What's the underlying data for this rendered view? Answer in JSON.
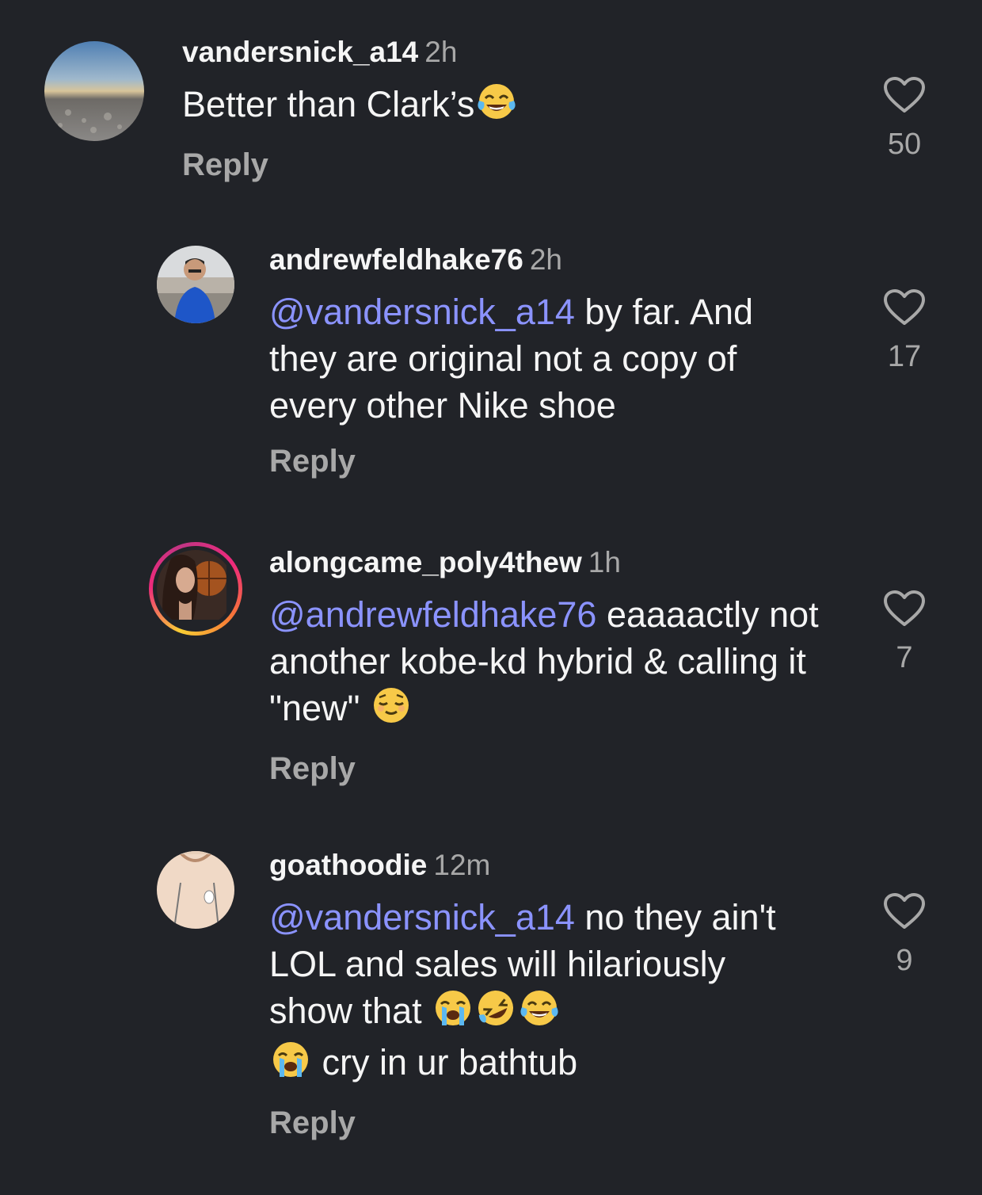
{
  "comments": [
    {
      "username": "vandersnick_a14",
      "time": "2h",
      "text": "Better than Clark’s",
      "emoji_after": "tears-of-joy-emoji",
      "reply_label": "Reply",
      "likes": "50"
    },
    {
      "username": "andrewfeldhake76",
      "time": "2h",
      "mention": "@vandersnick_a14",
      "text": " by far. And they are original not a copy of every other Nike shoe",
      "reply_label": "Reply",
      "likes": "17"
    },
    {
      "username": "alongcame_poly4thew",
      "time": "1h",
      "mention": "@andrewfeldhake76",
      "text": " eaaaactly not another kobe-kd hybrid & calling it \"new\" ",
      "emoji_after": "relieved-face-emoji",
      "reply_label": "Reply",
      "likes": "7"
    },
    {
      "username": "goathoodie",
      "time": "12m",
      "mention": "@vandersnick_a14",
      "text": " no they ain't LOL and sales will hilariously show that ",
      "emojis": [
        "loudly-crying-emoji",
        "rolling-laughing-emoji",
        "tears-of-joy-emoji",
        "loudly-crying-emoji"
      ],
      "text_after": " cry in ur bathtub",
      "reply_label": "Reply",
      "likes": "9"
    }
  ],
  "colors": {
    "background": "#212328",
    "text": "#f5f5f5",
    "secondary": "#a8a8a8",
    "mention": "#8b93ff"
  }
}
